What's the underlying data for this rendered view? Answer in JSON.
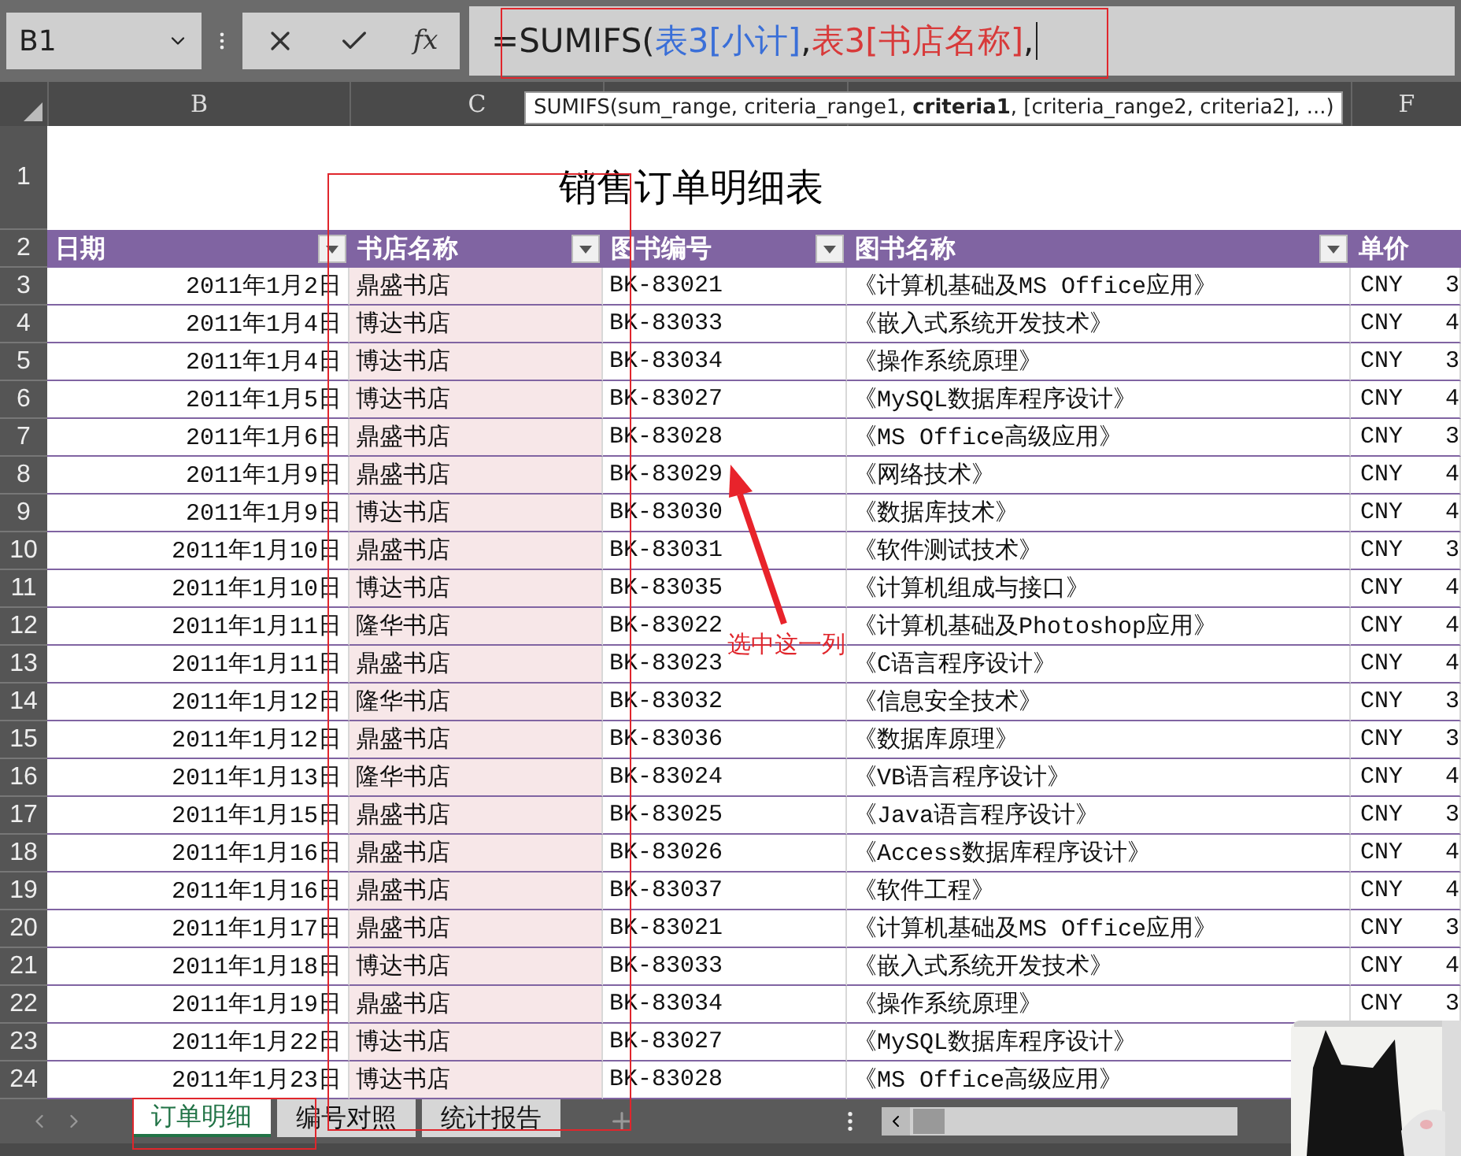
{
  "name_box": "B1",
  "fx_label": "fx",
  "formula": [
    {
      "text": "=SUMIFS(",
      "color": "#202020"
    },
    {
      "text": "表3[小计]",
      "color": "#3a6fd8",
      "suffix": ","
    },
    {
      "text": "表3[书店名称]",
      "color": "#d83a3a",
      "suffix": ","
    }
  ],
  "column_headers": [
    "B",
    "C",
    "F"
  ],
  "tooltip": "SUMIFS(sum_range, criteria_range1, **criteria1**, [criteria_range2, criteria2], ...)",
  "title_row": {
    "num": "1",
    "title": "销售订单明细表"
  },
  "header_row": {
    "num": "2",
    "columns": [
      {
        "label": "日期",
        "filter": true
      },
      {
        "label": "书店名称",
        "filter": true
      },
      {
        "label": "图书编号",
        "filter": true
      },
      {
        "label": "图书名称",
        "filter": true
      },
      {
        "label": "单价",
        "filter": false
      }
    ]
  },
  "rows": [
    {
      "num": "3",
      "date": "2011年1月2日",
      "store": "鼎盛书店",
      "code": "BK-83021",
      "book": "《计算机基础及MS Office应用》",
      "currency": "CNY",
      "price": "3"
    },
    {
      "num": "4",
      "date": "2011年1月4日",
      "store": "博达书店",
      "code": "BK-83033",
      "book": "《嵌入式系统开发技术》",
      "currency": "CNY",
      "price": "4"
    },
    {
      "num": "5",
      "date": "2011年1月4日",
      "store": "博达书店",
      "code": "BK-83034",
      "book": "《操作系统原理》",
      "currency": "CNY",
      "price": "3"
    },
    {
      "num": "6",
      "date": "2011年1月5日",
      "store": "博达书店",
      "code": "BK-83027",
      "book": "《MySQL数据库程序设计》",
      "currency": "CNY",
      "price": "4"
    },
    {
      "num": "7",
      "date": "2011年1月6日",
      "store": "鼎盛书店",
      "code": "BK-83028",
      "book": "《MS Office高级应用》",
      "currency": "CNY",
      "price": "3"
    },
    {
      "num": "8",
      "date": "2011年1月9日",
      "store": "鼎盛书店",
      "code": "BK-83029",
      "book": "《网络技术》",
      "currency": "CNY",
      "price": "4"
    },
    {
      "num": "9",
      "date": "2011年1月9日",
      "store": "博达书店",
      "code": "BK-83030",
      "book": "《数据库技术》",
      "currency": "CNY",
      "price": "4"
    },
    {
      "num": "10",
      "date": "2011年1月10日",
      "store": "鼎盛书店",
      "code": "BK-83031",
      "book": "《软件测试技术》",
      "currency": "CNY",
      "price": "3"
    },
    {
      "num": "11",
      "date": "2011年1月10日",
      "store": "博达书店",
      "code": "BK-83035",
      "book": "《计算机组成与接口》",
      "currency": "CNY",
      "price": "4"
    },
    {
      "num": "12",
      "date": "2011年1月11日",
      "store": "隆华书店",
      "code": "BK-83022",
      "book": "《计算机基础及Photoshop应用》",
      "currency": "CNY",
      "price": "4"
    },
    {
      "num": "13",
      "date": "2011年1月11日",
      "store": "鼎盛书店",
      "code": "BK-83023",
      "book": "《C语言程序设计》",
      "currency": "CNY",
      "price": "4"
    },
    {
      "num": "14",
      "date": "2011年1月12日",
      "store": "隆华书店",
      "code": "BK-83032",
      "book": "《信息安全技术》",
      "currency": "CNY",
      "price": "3"
    },
    {
      "num": "15",
      "date": "2011年1月12日",
      "store": "鼎盛书店",
      "code": "BK-83036",
      "book": "《数据库原理》",
      "currency": "CNY",
      "price": "3"
    },
    {
      "num": "16",
      "date": "2011年1月13日",
      "store": "隆华书店",
      "code": "BK-83024",
      "book": "《VB语言程序设计》",
      "currency": "CNY",
      "price": "4"
    },
    {
      "num": "17",
      "date": "2011年1月15日",
      "store": "鼎盛书店",
      "code": "BK-83025",
      "book": "《Java语言程序设计》",
      "currency": "CNY",
      "price": "3"
    },
    {
      "num": "18",
      "date": "2011年1月16日",
      "store": "鼎盛书店",
      "code": "BK-83026",
      "book": "《Access数据库程序设计》",
      "currency": "CNY",
      "price": "4"
    },
    {
      "num": "19",
      "date": "2011年1月16日",
      "store": "鼎盛书店",
      "code": "BK-83037",
      "book": "《软件工程》",
      "currency": "CNY",
      "price": "4"
    },
    {
      "num": "20",
      "date": "2011年1月17日",
      "store": "鼎盛书店",
      "code": "BK-83021",
      "book": "《计算机基础及MS Office应用》",
      "currency": "CNY",
      "price": "3"
    },
    {
      "num": "21",
      "date": "2011年1月18日",
      "store": "博达书店",
      "code": "BK-83033",
      "book": "《嵌入式系统开发技术》",
      "currency": "CNY",
      "price": "4"
    },
    {
      "num": "22",
      "date": "2011年1月19日",
      "store": "鼎盛书店",
      "code": "BK-83034",
      "book": "《操作系统原理》",
      "currency": "CNY",
      "price": "3"
    },
    {
      "num": "23",
      "date": "2011年1月22日",
      "store": "博达书店",
      "code": "BK-83027",
      "book": "《MySQL数据库程序设计》"
    },
    {
      "num": "24",
      "date": "2011年1月23日",
      "store": "博达书店",
      "code": "BK-83028",
      "book": "《MS Office高级应用》"
    }
  ],
  "sheet_tabs": [
    {
      "label": "订单明细",
      "selected": true
    },
    {
      "label": "编号对照",
      "selected": false
    },
    {
      "label": "统计报告",
      "selected": false
    }
  ],
  "annotation": {
    "label": "选中这一列"
  }
}
